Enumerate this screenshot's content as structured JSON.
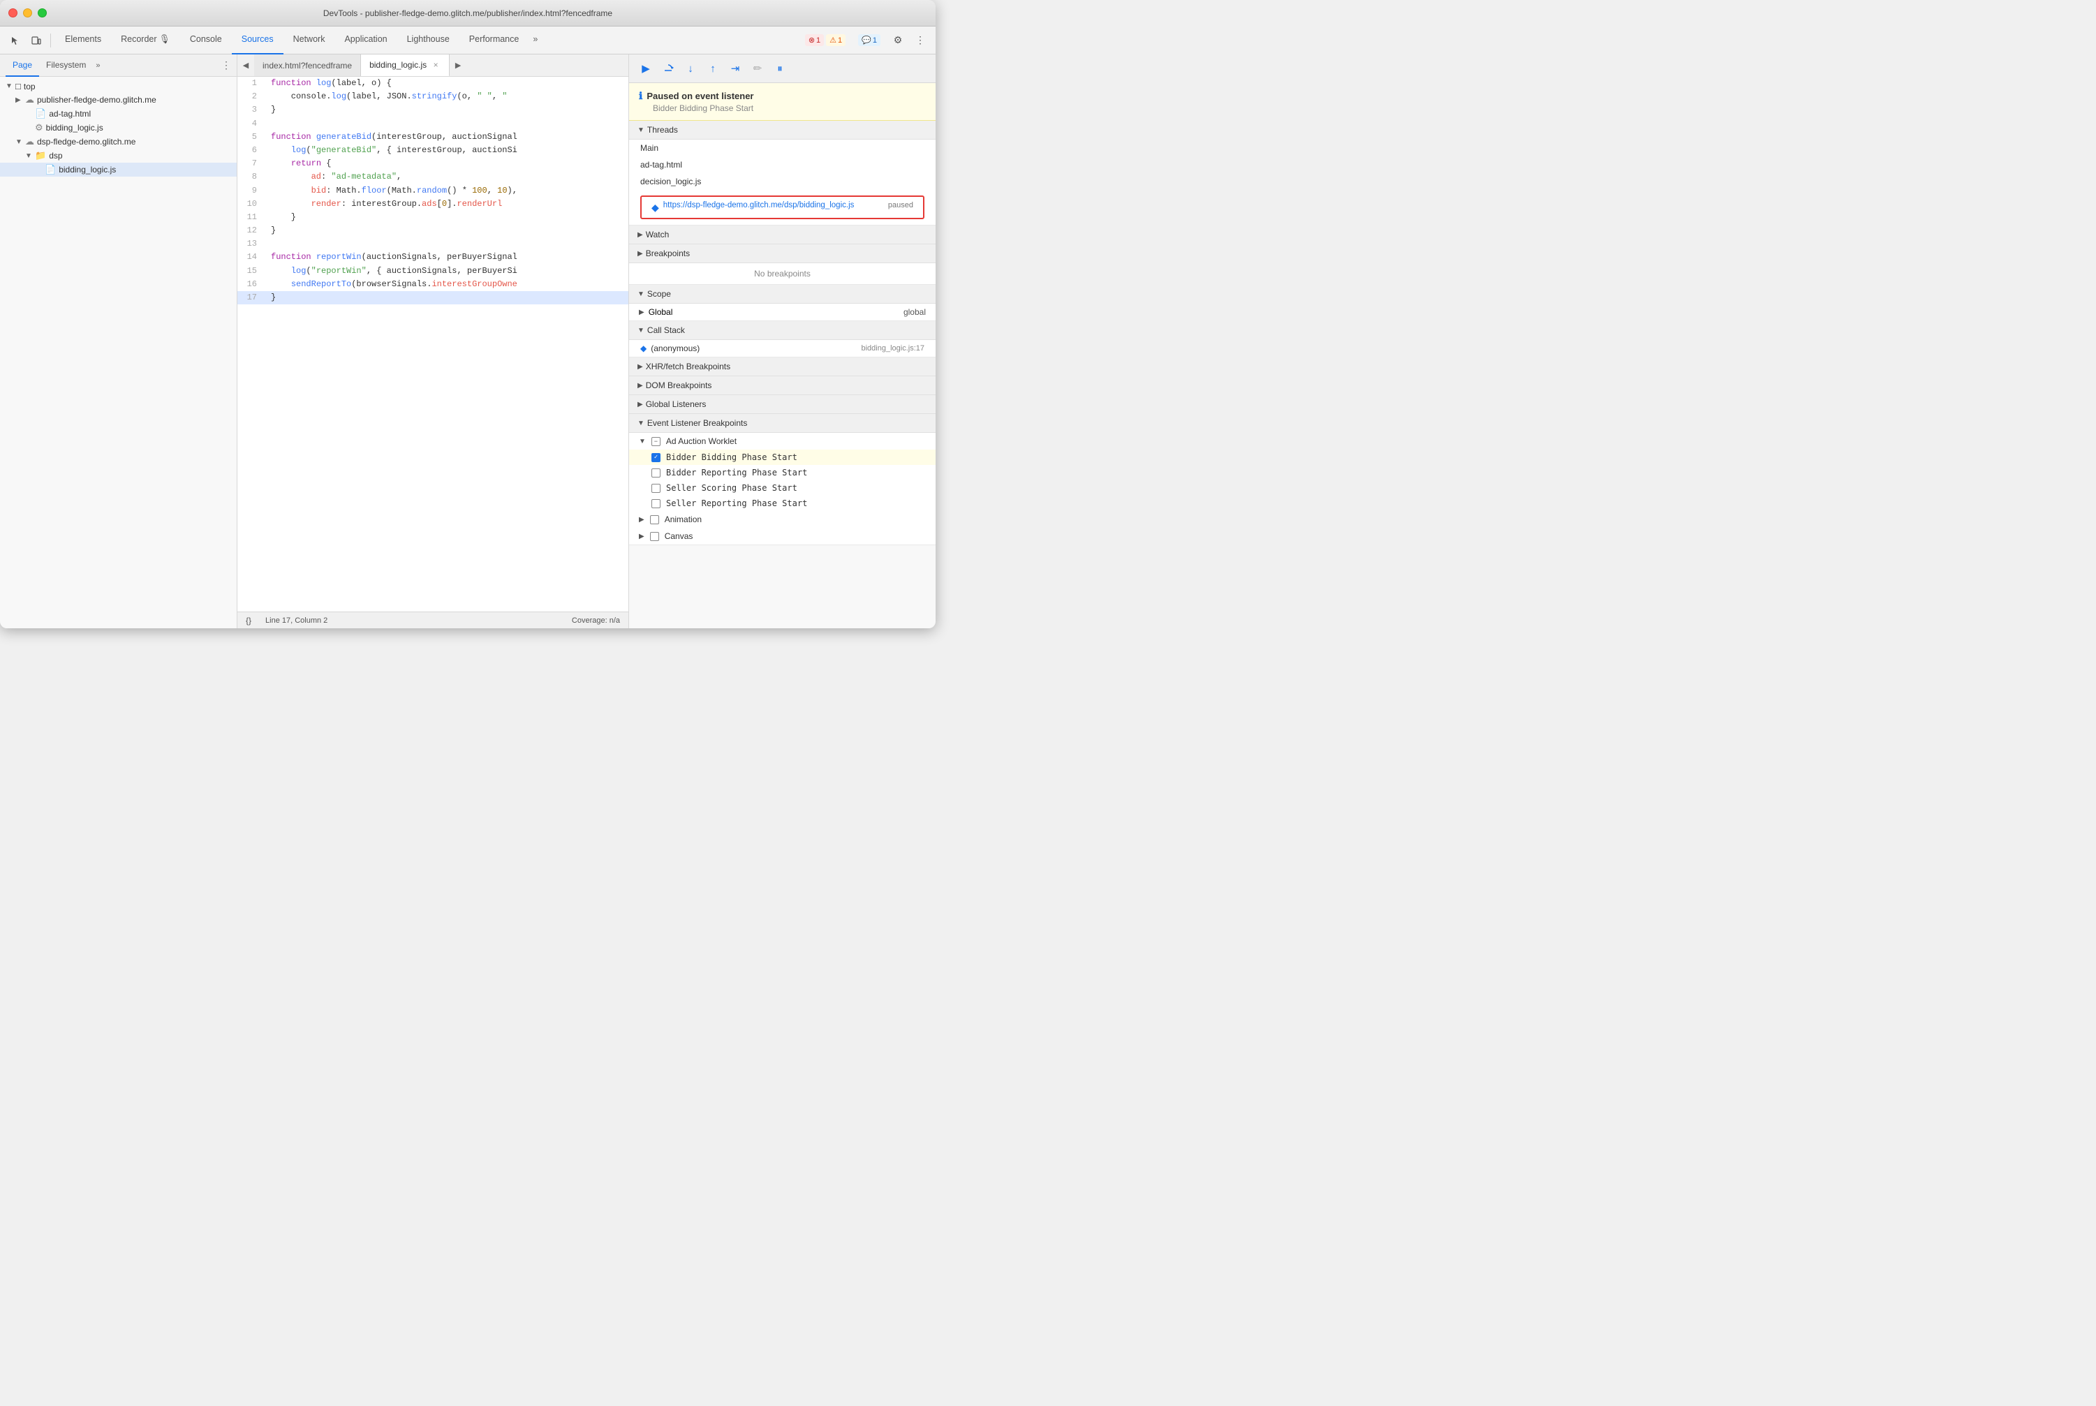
{
  "window": {
    "title": "DevTools - publisher-fledge-demo.glitch.me/publisher/index.html?fencedframe"
  },
  "toolbar": {
    "tabs": [
      {
        "id": "elements",
        "label": "Elements",
        "active": false
      },
      {
        "id": "recorder",
        "label": "Recorder 🎤",
        "active": false
      },
      {
        "id": "console",
        "label": "Console",
        "active": false
      },
      {
        "id": "sources",
        "label": "Sources",
        "active": true
      },
      {
        "id": "network",
        "label": "Network",
        "active": false
      },
      {
        "id": "application",
        "label": "Application",
        "active": false
      },
      {
        "id": "lighthouse",
        "label": "Lighthouse",
        "active": false
      },
      {
        "id": "performance",
        "label": "Performance",
        "active": false
      }
    ],
    "more_label": "»",
    "error_count": "1",
    "warning_count": "1",
    "info_count": "1"
  },
  "left_panel": {
    "tabs": [
      {
        "id": "page",
        "label": "Page",
        "active": true
      },
      {
        "id": "filesystem",
        "label": "Filesystem",
        "active": false
      }
    ],
    "more": "»",
    "tree": [
      {
        "id": "top",
        "label": "top",
        "indent": 0,
        "type": "folder-closed",
        "expanded": true
      },
      {
        "id": "publisher",
        "label": "publisher-fledge-demo.glitch.me",
        "indent": 1,
        "type": "cloud"
      },
      {
        "id": "adtag",
        "label": "ad-tag.html",
        "indent": 1,
        "type": "file"
      },
      {
        "id": "bidding_logic_folder",
        "label": "bidding_logic.js",
        "indent": 1,
        "type": "gear-file",
        "selected": false
      },
      {
        "id": "dsp_fledge",
        "label": "dsp-fledge-demo.glitch.me",
        "indent": 1,
        "type": "cloud"
      },
      {
        "id": "dsp_folder",
        "label": "dsp",
        "indent": 2,
        "type": "folder"
      },
      {
        "id": "bidding_logic_js",
        "label": "bidding_logic.js",
        "indent": 3,
        "type": "js-file",
        "selected": true
      }
    ]
  },
  "editor": {
    "tabs": [
      {
        "id": "index",
        "label": "index.html?fencedframe",
        "active": false,
        "closeable": false
      },
      {
        "id": "bidding",
        "label": "bidding_logic.js",
        "active": true,
        "closeable": true
      }
    ],
    "code_lines": [
      {
        "num": 1,
        "code": "function log(label, o) {"
      },
      {
        "num": 2,
        "code": "    console.log(label, JSON.stringify(o, \" \", \""
      },
      {
        "num": 3,
        "code": "}"
      },
      {
        "num": 4,
        "code": ""
      },
      {
        "num": 5,
        "code": "function generateBid(interestGroup, auctionSignal"
      },
      {
        "num": 6,
        "code": "    log(\"generateBid\", { interestGroup, auctionSi"
      },
      {
        "num": 7,
        "code": "    return {"
      },
      {
        "num": 8,
        "code": "        ad: \"ad-metadata\","
      },
      {
        "num": 9,
        "code": "        bid: Math.floor(Math.random() * 100, 10),"
      },
      {
        "num": 10,
        "code": "        render: interestGroup.ads[0].renderUrl"
      },
      {
        "num": 11,
        "code": "    }"
      },
      {
        "num": 12,
        "code": "}"
      },
      {
        "num": 13,
        "code": ""
      },
      {
        "num": 14,
        "code": "function reportWin(auctionSignals, perBuyerSignal"
      },
      {
        "num": 15,
        "code": "    log(\"reportWin\", { auctionSignals, perBuyerSi"
      },
      {
        "num": 16,
        "code": "    sendReportTo(browserSignals.interestGroupOwne"
      },
      {
        "num": 17,
        "code": "}",
        "highlighted": true
      }
    ],
    "statusbar": {
      "format_btn": "{}",
      "position": "Line 17, Column 2",
      "coverage": "Coverage: n/a"
    }
  },
  "right_panel": {
    "debug_btns": [
      "▶",
      "⟳",
      "⬇",
      "⬆",
      "⬇⬇",
      "✏",
      "⏸"
    ],
    "paused_banner": {
      "icon": "ℹ",
      "title": "Paused on event listener",
      "subtitle": "Bidder Bidding Phase Start"
    },
    "threads": {
      "section_label": "Threads",
      "items": [
        {
          "id": "main",
          "label": "Main"
        },
        {
          "id": "adtag",
          "label": "ad-tag.html"
        },
        {
          "id": "decision",
          "label": "decision_logic.js"
        }
      ],
      "active_thread": {
        "url": "https://dsp-fledge-demo.glitch.me/dsp/bidding_logic.js",
        "status": "paused"
      }
    },
    "watch": {
      "section_label": "Watch"
    },
    "breakpoints": {
      "section_label": "Breakpoints",
      "empty_label": "No breakpoints"
    },
    "scope": {
      "section_label": "Scope",
      "global": {
        "label": "Global",
        "value": "global"
      }
    },
    "call_stack": {
      "section_label": "Call Stack",
      "items": [
        {
          "id": "anon",
          "label": "(anonymous)",
          "loc": "bidding_logic.js:17",
          "active": true
        }
      ]
    },
    "xhr_breakpoints": {
      "section_label": "XHR/fetch Breakpoints"
    },
    "dom_breakpoints": {
      "section_label": "DOM Breakpoints"
    },
    "global_listeners": {
      "section_label": "Global Listeners"
    },
    "event_listener_breakpoints": {
      "section_label": "Event Listener Breakpoints",
      "categories": [
        {
          "id": "ad_auction",
          "label": "Ad Auction Worklet",
          "expanded": true,
          "items": [
            {
              "id": "bidder_bidding",
              "label": "Bidder Bidding Phase Start",
              "checked": true,
              "highlighted": true
            },
            {
              "id": "bidder_reporting",
              "label": "Bidder Reporting Phase Start",
              "checked": false
            },
            {
              "id": "seller_scoring",
              "label": "Seller Scoring Phase Start",
              "checked": false
            },
            {
              "id": "seller_reporting",
              "label": "Seller Reporting Phase Start",
              "checked": false
            }
          ]
        },
        {
          "id": "animation",
          "label": "Animation",
          "expanded": false
        }
      ]
    },
    "canvas": {
      "section_label": "Canvas"
    }
  }
}
